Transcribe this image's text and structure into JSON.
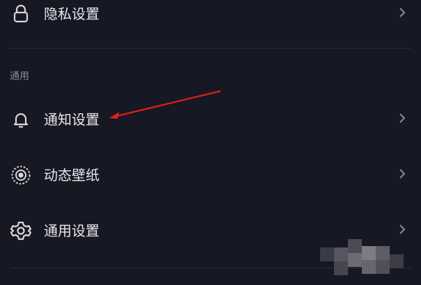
{
  "settings": {
    "privacy_label": "隐私设置",
    "section_general": "通用",
    "notify_label": "通知设置",
    "wallpaper_label": "动态壁纸",
    "general_label": "通用设置"
  },
  "icons": {
    "privacy": "lock-icon",
    "notify": "bell-icon",
    "wallpaper": "wallpaper-icon",
    "general": "gear-icon",
    "chevron": "chevron-right-icon"
  },
  "colors": {
    "background": "#161823",
    "text": "#e9e9ec",
    "section_text": "#8a8b93",
    "annotation_arrow": "#e0201b"
  }
}
